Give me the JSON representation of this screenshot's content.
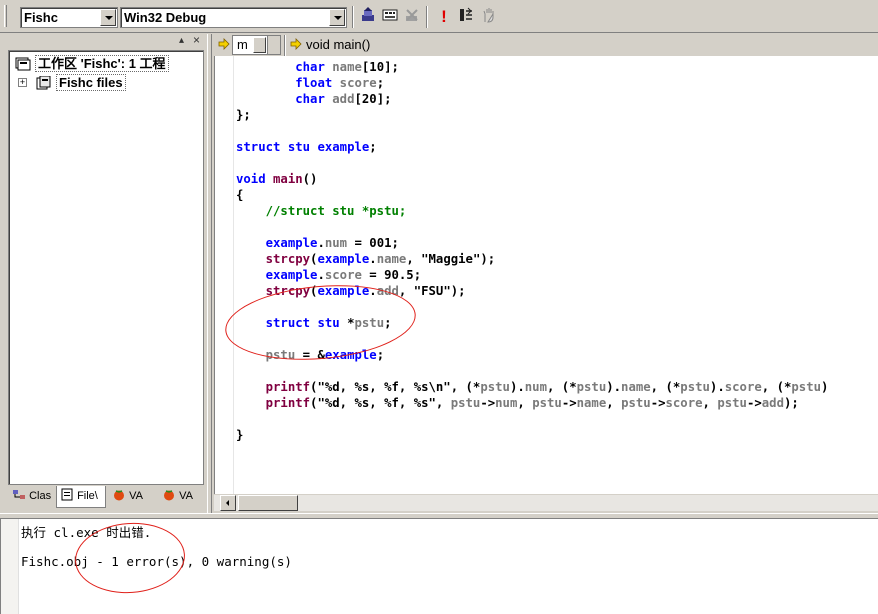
{
  "toolbar": {
    "project_combo": "Fishc",
    "config_combo": "Win32 Debug",
    "icons": [
      "compile-icon",
      "build-icon",
      "stop-build-icon",
      "execute-icon",
      "go-icon",
      "breakpoint-icon"
    ]
  },
  "workspace": {
    "root_label": "工作区 'Fishc': 1 工程",
    "project_label": "Fishc files",
    "tabs": [
      {
        "label": "Clas",
        "icon": "class-view-icon"
      },
      {
        "label": "File\\",
        "icon": "file-view-icon"
      },
      {
        "label": "VA",
        "icon": "tomato-icon"
      },
      {
        "label": "VA",
        "icon": "tomato-icon"
      }
    ]
  },
  "editor_bar": {
    "scope_combo": "m",
    "function_label": "void main()"
  },
  "code_lines": [
    "        char name[10];",
    "        float score;",
    "        char add[20];",
    "};",
    "",
    "struct stu example;",
    "",
    "void main()",
    "{",
    "    //struct stu *pstu;",
    "",
    "    example.num = 001;",
    "    strcpy(example.name, \"Maggie\");",
    "    example.score = 90.5;",
    "    strcpy(example.add, \"FSU\");",
    "",
    "    struct stu *pstu;",
    "",
    "    pstu = &example;",
    "",
    "    printf(\"%d, %s, %f, %s\\n\", (*pstu).num, (*pstu).name, (*pstu).score, (*pstu)",
    "    printf(\"%d, %s, %f, %s\", pstu->num, pstu->name, pstu->score, pstu->add);",
    "",
    "}"
  ],
  "output": {
    "line1": "执行 cl.exe 时出错.",
    "line2": "Fishc.obj - 1 error(s), 0 warning(s)"
  },
  "annotation_color": "#e0201a"
}
